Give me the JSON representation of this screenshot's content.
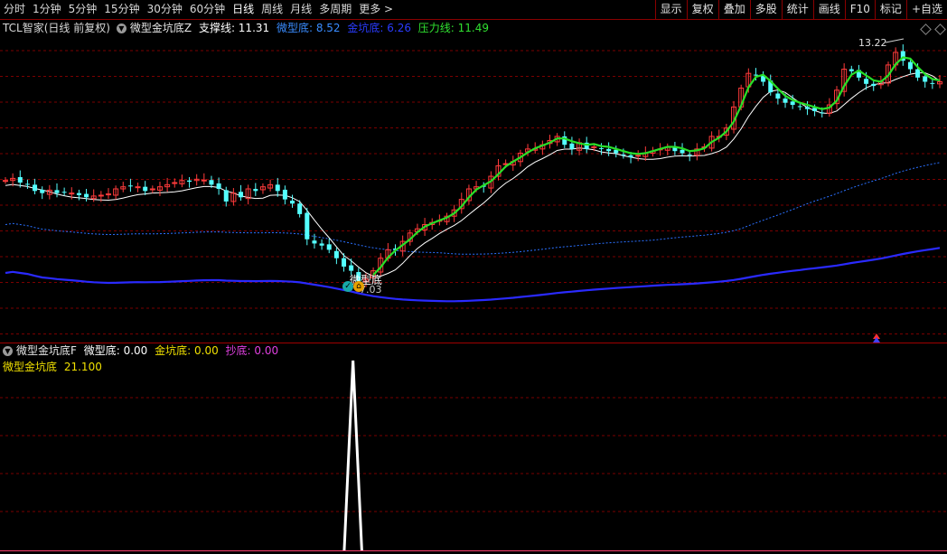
{
  "periods": [
    "分时",
    "1分钟",
    "5分钟",
    "15分钟",
    "30分钟",
    "60分钟",
    "日线",
    "周线",
    "月线",
    "多周期",
    "更多 >"
  ],
  "active_period": "日线",
  "right_menu": [
    "显示",
    "复权",
    "叠加",
    "多股",
    "统计",
    "画线",
    "F10",
    "标记",
    "+自选"
  ],
  "main_legend": {
    "stock": "TCL智家(日线 前复权)",
    "indicator": "微型金坑底Z",
    "support": "支撑线: 11.31",
    "micro": "微型底: 8.52",
    "gold": "金坑底: 6.26",
    "pressure": "压力线: 11.49"
  },
  "sub_legend": {
    "indicator": "微型金坑底F",
    "micro": "微型底: 0.00",
    "gold": "金坑底: 0.00",
    "chao": "抄底: 0.00",
    "second_name": "微型金坑底",
    "second_val": "21.100"
  },
  "annotations": {
    "high_price": "13.22",
    "low_price": "7.03",
    "signal_label": "微型底"
  },
  "colors": {
    "up": "#ff3b3b",
    "down": "#54ffff",
    "green_line": "#28e028",
    "white_line": "#ffffff",
    "blue_dotted": "#2a70ff",
    "blue_solid": "#2a2aff",
    "grid": "#7a0000"
  },
  "chart_data": [
    {
      "type": "candlestick",
      "title": "TCL智家(日线 前复权)",
      "ylim": [
        6.5,
        13.6
      ],
      "close": [
        10.25,
        10.3,
        10.2,
        10.15,
        10.0,
        9.95,
        10.02,
        9.95,
        9.97,
        9.95,
        9.9,
        9.85,
        9.88,
        9.9,
        9.93,
        10.05,
        10.1,
        10.12,
        10.1,
        10.0,
        10.05,
        10.1,
        10.15,
        10.2,
        10.25,
        10.22,
        10.28,
        10.26,
        10.15,
        10.05,
        9.75,
        9.95,
        9.85,
        10.05,
        10.0,
        10.1,
        10.15,
        10.0,
        9.8,
        9.7,
        9.45,
        8.85,
        8.75,
        8.7,
        8.6,
        8.4,
        8.2,
        8.1,
        7.85,
        7.9,
        8.1,
        8.4,
        8.6,
        8.6,
        8.8,
        9.0,
        9.1,
        9.2,
        9.25,
        9.3,
        9.4,
        9.55,
        9.8,
        10.05,
        10.1,
        10.1,
        10.35,
        10.6,
        10.65,
        10.7,
        10.9,
        11.0,
        11.0,
        11.1,
        11.2,
        11.3,
        11.1,
        11.0,
        11.15,
        11.0,
        11.05,
        11.0,
        10.95,
        10.9,
        10.85,
        10.8,
        10.85,
        10.9,
        10.95,
        11.0,
        11.05,
        10.95,
        10.9,
        10.85,
        11.0,
        11.05,
        11.3,
        11.3,
        11.5,
        12.0,
        12.45,
        12.8,
        12.75,
        12.6,
        12.35,
        12.2,
        12.1,
        12.05,
        12.0,
        11.95,
        11.9,
        11.85,
        12.05,
        12.4,
        12.9,
        12.85,
        12.7,
        12.55,
        12.5,
        12.6,
        13.0,
        13.3,
        13.1,
        12.9,
        12.7,
        12.6,
        12.55,
        12.6
      ],
      "series": [
        {
          "name": "压力线",
          "color": "green"
        },
        {
          "name": "支撑线",
          "color": "white"
        },
        {
          "name": "金坑底",
          "color": "blue dotted"
        },
        {
          "name": "微型底",
          "color": "blue solid"
        }
      ],
      "annotations": [
        "13.22",
        "7.03",
        "微型底"
      ]
    },
    {
      "type": "line",
      "title": "微型金坑底F",
      "peak": 21.1,
      "values": [
        0,
        0,
        0,
        0,
        0,
        0,
        0,
        0,
        0,
        0,
        0,
        0,
        0,
        0,
        0,
        0,
        0,
        0,
        0,
        0,
        0,
        0,
        0,
        0,
        0,
        0,
        0,
        0,
        0,
        0,
        0,
        0,
        0,
        0,
        0,
        0,
        0,
        0,
        0,
        0,
        0,
        0,
        0,
        0,
        0,
        0,
        0,
        21.1,
        0,
        0,
        0,
        0,
        0,
        0,
        0,
        0,
        0,
        0,
        0,
        0,
        0,
        0,
        0,
        0,
        0,
        0,
        0,
        0,
        0,
        0,
        0,
        0,
        0,
        0,
        0,
        0,
        0,
        0,
        0,
        0,
        0,
        0,
        0,
        0,
        0,
        0,
        0,
        0,
        0,
        0,
        0,
        0,
        0,
        0,
        0,
        0,
        0,
        0,
        0,
        0,
        0,
        0,
        0,
        0,
        0,
        0,
        0,
        0,
        0,
        0,
        0,
        0,
        0,
        0,
        0,
        0,
        0,
        0,
        0,
        0,
        0,
        0,
        0,
        0,
        0,
        0,
        0,
        0
      ]
    }
  ]
}
